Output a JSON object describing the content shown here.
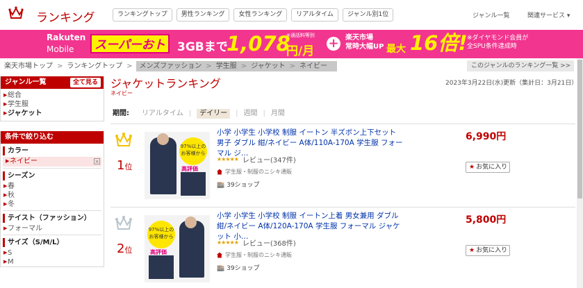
{
  "header": {
    "logo_text": "ランキング",
    "tabs": [
      "ランキングトップ",
      "男性ランキング",
      "女性ランキング",
      "リアルタイム",
      "ジャンル別1位"
    ],
    "genre_list": "ジャンル一覧",
    "related_services": "関連サービス ▾"
  },
  "banner": {
    "rakuten": "Rakuten",
    "mobile": "Mobile",
    "sale": "スーパーおトク",
    "data": "3GBまで",
    "price": "1,078",
    "yen_month": "円/月",
    "call_note": "※通話料等別",
    "ichiba_1": "楽天市場",
    "ichiba_2": "常時大幅UP",
    "max": "最大",
    "multiplier": "16倍!",
    "diamond_1": "※ダイヤモンド会員が",
    "diamond_2": "全SPU条件達成時"
  },
  "breadcrumb": {
    "items": [
      "楽天市場トップ",
      "ランキングトップ"
    ],
    "current": [
      "メンズファッション",
      "学生服",
      "ジャケット",
      "ネイビー"
    ],
    "sep": ">",
    "genre_link": "このジャンルのランキング一覧 >>"
  },
  "sidebar": {
    "genre_title": "ジャンル一覧",
    "show_all": "全て見る",
    "genres": [
      "総合",
      "学生服",
      "ジャケット"
    ],
    "filter_title": "条件で絞り込む",
    "color_label": "カラー",
    "color_selected": "ネイビー",
    "season_label": "シーズン",
    "seasons": [
      "春",
      "秋",
      "冬"
    ],
    "taste_label": "テイスト（ファッション）",
    "tastes": [
      "フォーマル"
    ],
    "size_label": "サイズ（S/M/L）",
    "sizes": [
      "S",
      "M"
    ]
  },
  "main": {
    "title": "ジャケットランキング",
    "subtitle": "ネイビー",
    "updated": "2023年3月22日(水)更新（集計日：3月21日）",
    "period_label": "期間:",
    "periods": [
      "リアルタイム",
      "デイリー",
      "週間",
      "月間"
    ]
  },
  "items": [
    {
      "rank": "1",
      "rank_suffix": "位",
      "title": "小学 小学生 小学校 制服 イートン 半ズボン上下セット 男子 ダブル 紺/ネイビー A体/110A-170A 学生服 フォーマル ジ…",
      "stars": "★★★★★",
      "review": "レビュー(347件)",
      "shop": "学生服・制服のニシキ通販",
      "shop_count": "39ショップ",
      "price": "6,990円",
      "fav": "お気に入り",
      "badge": "97%以上のお客様から",
      "badge_hyoka": "高評価",
      "crown_color": "#f2c200"
    },
    {
      "rank": "2",
      "rank_suffix": "位",
      "title": "小学 小学生 小学校 制服 イートン上着 男女兼用 ダブル 紺/ネイビー A体/120A-170A 学生服 フォーマル ジャケット 小…",
      "stars": "★★★★★",
      "review": "レビュー(368件)",
      "shop": "学生服・制服のニシキ通販",
      "shop_count": "39ショップ",
      "price": "5,800円",
      "fav": "お気に入り",
      "badge": "97%以上のお客様から",
      "badge_hyoka": "高評価",
      "crown_color": "#b8c4cc"
    }
  ]
}
